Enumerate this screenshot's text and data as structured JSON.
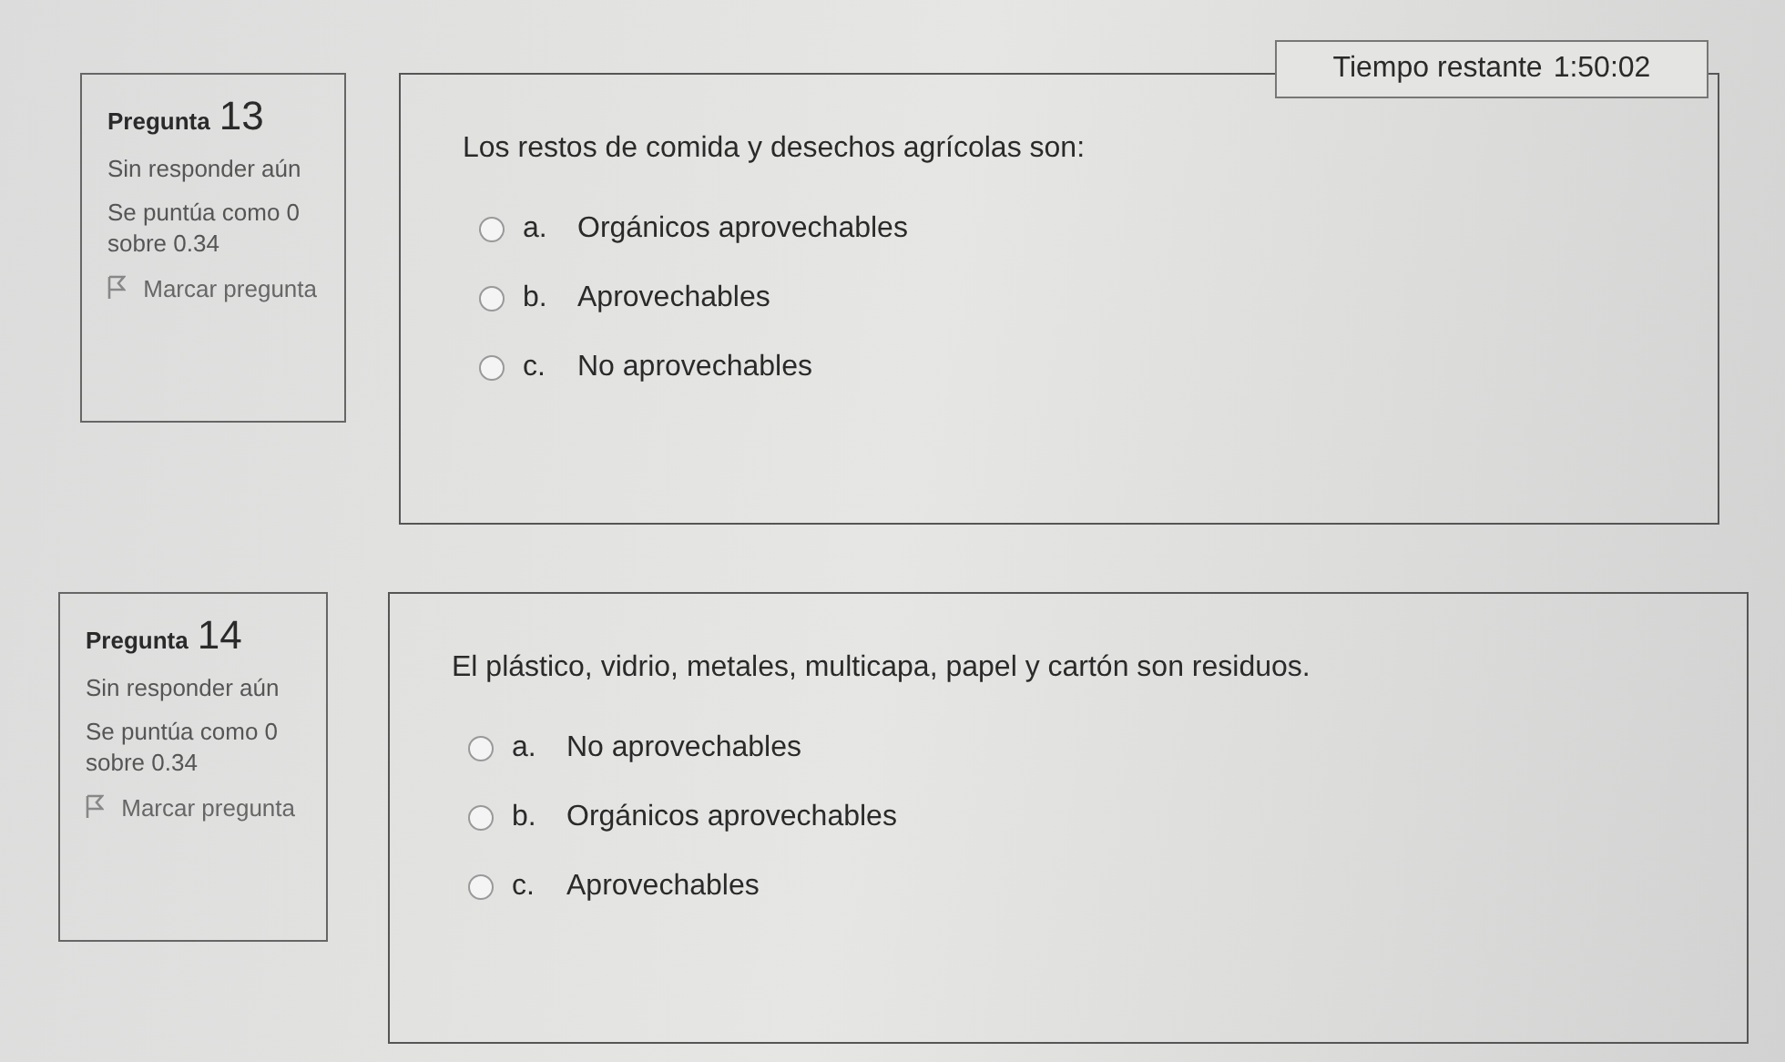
{
  "timer": {
    "label": "Tiempo restante",
    "value": "1:50:02"
  },
  "questions": [
    {
      "label": "Pregunta",
      "number": "13",
      "status": "Sin responder aún",
      "grade": "Se puntúa como 0 sobre 0.34",
      "flag": {
        "label": "Marcar pregunta",
        "flagged": false
      },
      "text": "Los restos de comida y desechos agrícolas son:",
      "options": [
        {
          "letter": "a.",
          "text": "Orgánicos aprovechables",
          "selected": false
        },
        {
          "letter": "b.",
          "text": "Aprovechables",
          "selected": false
        },
        {
          "letter": "c.",
          "text": "No aprovechables",
          "selected": false
        }
      ]
    },
    {
      "label": "Pregunta",
      "number": "14",
      "status": "Sin responder aún",
      "grade": "Se puntúa como 0 sobre 0.34",
      "flag": {
        "label": "Marcar pregunta",
        "flagged": false
      },
      "text": "El plástico, vidrio, metales, multicapa, papel y cartón son residuos.",
      "options": [
        {
          "letter": "a.",
          "text": "No aprovechables",
          "selected": false
        },
        {
          "letter": "b.",
          "text": "Orgánicos aprovechables",
          "selected": false
        },
        {
          "letter": "c.",
          "text": "Aprovechables",
          "selected": false
        }
      ]
    }
  ]
}
